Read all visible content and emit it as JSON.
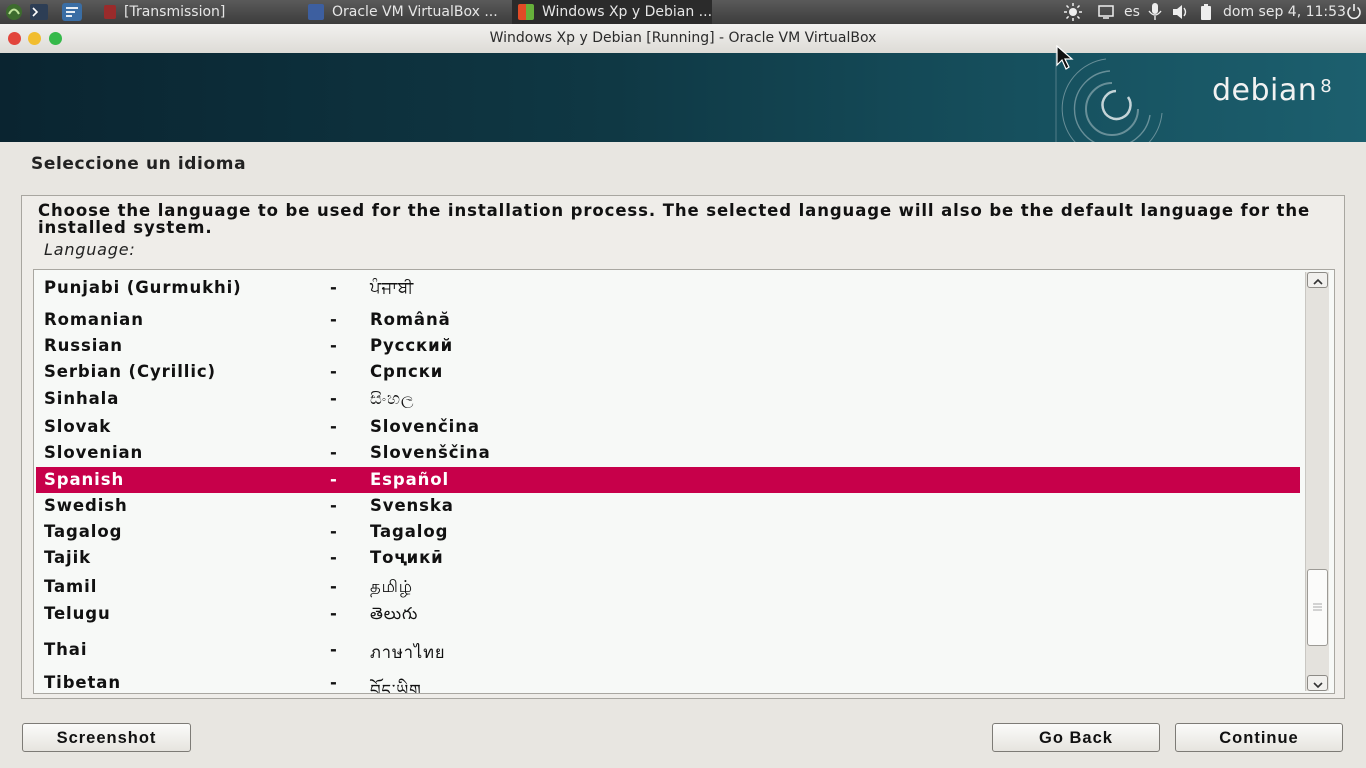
{
  "panel": {
    "tasks": [
      {
        "label": "[Transmission]"
      },
      {
        "label": "Oracle VM VirtualBox ..."
      },
      {
        "label": "Windows Xp y Debian ..."
      }
    ],
    "keyboard_layout": "es",
    "clock": "dom sep  4, 11:53"
  },
  "window": {
    "title": "Windows Xp y Debian [Running] - Oracle VM VirtualBox"
  },
  "banner": {
    "logo_text": "debian",
    "logo_version": "8"
  },
  "installer": {
    "heading": "Seleccione un idioma",
    "description": "Choose the language to be used for the installation process. The selected language will also be the default language for the installed system.",
    "list_label": "Language:",
    "separator": "-",
    "selected": "Spanish",
    "languages": [
      {
        "name": "Punjabi (Gurmukhi)",
        "native": "ਪੰਜਾਬੀ"
      },
      {
        "name": "Romanian",
        "native": "Română"
      },
      {
        "name": "Russian",
        "native": "Русский"
      },
      {
        "name": "Serbian (Cyrillic)",
        "native": "Српски"
      },
      {
        "name": "Sinhala",
        "native": "සිංහල"
      },
      {
        "name": "Slovak",
        "native": "Slovenčina"
      },
      {
        "name": "Slovenian",
        "native": "Slovenščina"
      },
      {
        "name": "Spanish",
        "native": "Español"
      },
      {
        "name": "Swedish",
        "native": "Svenska"
      },
      {
        "name": "Tagalog",
        "native": "Tagalog"
      },
      {
        "name": "Tajik",
        "native": "Тоҷикӣ"
      },
      {
        "name": "Tamil",
        "native": "தமிழ்"
      },
      {
        "name": "Telugu",
        "native": "తెలుగు"
      },
      {
        "name": "Thai",
        "native": "ภาษาไทย"
      },
      {
        "name": "Tibetan",
        "native": "བོད་ཡིག"
      }
    ],
    "buttons": {
      "screenshot": "Screenshot",
      "go_back": "Go Back",
      "continue": "Continue"
    }
  },
  "colors": {
    "selection": "#c7004a",
    "banner": "#0f3844"
  }
}
